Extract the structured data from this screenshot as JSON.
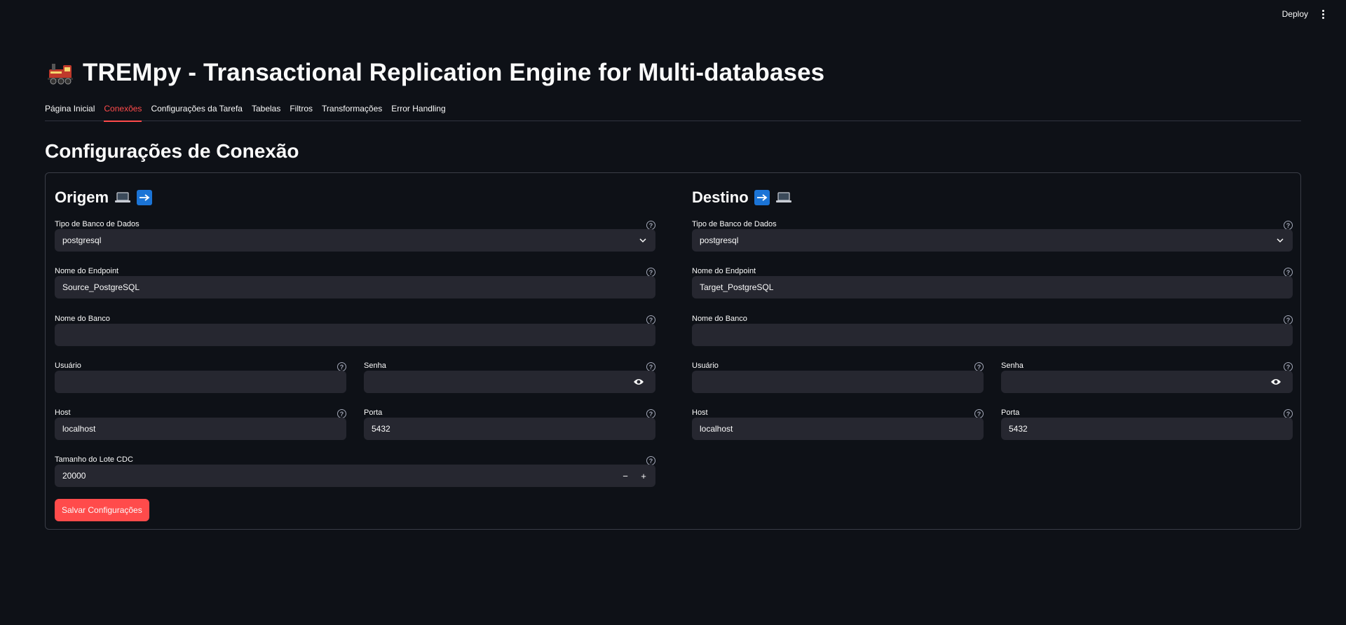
{
  "header": {
    "deploy_label": "Deploy"
  },
  "title": "TREMpy - Transactional Replication Engine for Multi-databases",
  "tabs": [
    {
      "label": "Página Inicial"
    },
    {
      "label": "Conexões"
    },
    {
      "label": "Configurações da Tarefa"
    },
    {
      "label": "Tabelas"
    },
    {
      "label": "Filtros"
    },
    {
      "label": "Transformações"
    },
    {
      "label": "Error Handling"
    }
  ],
  "active_tab": "Conexões",
  "section_title": "Configurações de Conexão",
  "origem": {
    "heading": "Origem",
    "db_type_label": "Tipo de Banco de Dados",
    "db_type_value": "postgresql",
    "endpoint_label": "Nome do Endpoint",
    "endpoint_value": "Source_PostgreSQL",
    "dbname_label": "Nome do Banco",
    "dbname_value": "",
    "user_label": "Usuário",
    "user_value": "",
    "password_label": "Senha",
    "password_value": "",
    "host_label": "Host",
    "host_value": "localhost",
    "port_label": "Porta",
    "port_value": "5432",
    "batch_label": "Tamanho do Lote CDC",
    "batch_value": "20000"
  },
  "destino": {
    "heading": "Destino",
    "db_type_label": "Tipo de Banco de Dados",
    "db_type_value": "postgresql",
    "endpoint_label": "Nome do Endpoint",
    "endpoint_value": "Target_PostgreSQL",
    "dbname_label": "Nome do Banco",
    "dbname_value": "",
    "user_label": "Usuário",
    "user_value": "",
    "password_label": "Senha",
    "password_value": "",
    "host_label": "Host",
    "host_value": "localhost",
    "port_label": "Porta",
    "port_value": "5432"
  },
  "save_button_label": "Salvar Configurações",
  "stepper": {
    "minus": "−",
    "plus": "+"
  },
  "help_glyph": "?",
  "colors": {
    "accent": "#ff4b4b",
    "background": "#0e1117",
    "input_bg": "#262730",
    "arrow_blue": "#1b74d6"
  },
  "icons": [
    "train-icon",
    "laptop-icon",
    "right-arrow-icon",
    "help-icon",
    "chevron-down-icon",
    "eye-icon",
    "kebab-menu-icon"
  ]
}
